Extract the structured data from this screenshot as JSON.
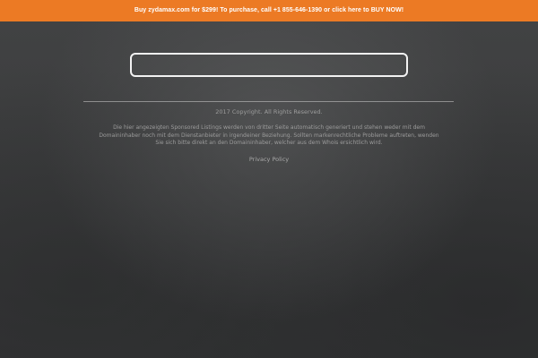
{
  "promo_bar": {
    "text": "Buy zydamax.com for $299! To purchase, call +1 855-646-1390 or click here to BUY NOW!",
    "color": "#ec7a24"
  },
  "search": {
    "value": ""
  },
  "footer": {
    "copyright": "2017 Copyright. All Rights Reserved.",
    "disclaimer": "Die hier angezeigten Sponsored Listings werden von dritter Seite automatisch generiert und stehen weder mit dem Domaininhaber noch mit dem Dienstanbieter in irgendeiner Beziehung. Sollten markenrechtliche Probleme auftreten, wenden Sie sich bitte direkt an den Domaininhaber, welcher aus dem Whois ersichtlich wird.",
    "privacy_label": "Privacy Policy"
  }
}
